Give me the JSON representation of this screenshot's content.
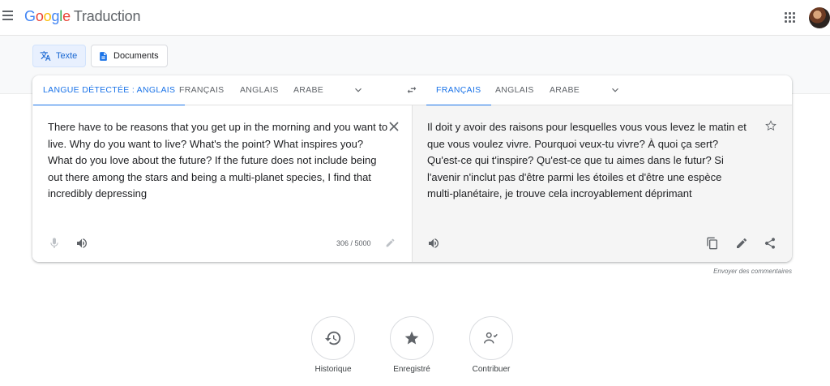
{
  "header": {
    "brand": [
      "G",
      "o",
      "o",
      "g",
      "l",
      "e"
    ],
    "product": "Traduction"
  },
  "modes": {
    "text": "Texte",
    "documents": "Documents"
  },
  "source_tabs": [
    "LANGUE DÉTECTÉE : ANGLAIS",
    "FRANÇAIS",
    "ANGLAIS",
    "ARABE"
  ],
  "target_tabs": [
    "FRANÇAIS",
    "ANGLAIS",
    "ARABE"
  ],
  "source_text": "There have to be reasons that you get up in the morning and you want to live. Why do you want to live? What's the point? What inspires you? What do you love about the future? If the future does not include being out there among the stars and being a multi-planet species, I find that incredibly depressing",
  "translated_text": "Il doit y avoir des raisons pour lesquelles vous vous levez le matin et que vous voulez vivre. Pourquoi veux-tu vivre? À quoi ça sert? Qu'est-ce qui t'inspire? Qu'est-ce que tu aimes dans le futur? Si l'avenir n'inclut pas d'être parmi les étoiles et d'être une espèce multi-planétaire, je trouve cela incroyablement déprimant",
  "char_count": "306 / 5000",
  "feedback": "Envoyer des commentaires",
  "bottom": {
    "history": "Historique",
    "saved": "Enregistré",
    "contribute": "Contribuer"
  },
  "icons": [
    "menu-icon",
    "apps-icon",
    "translate-icon",
    "document-icon",
    "chevron-down-icon",
    "swap-icon",
    "close-icon",
    "star-icon",
    "mic-icon",
    "speaker-icon",
    "pencil-icon",
    "copy-icon",
    "share-icon",
    "history-icon",
    "saved-star-icon",
    "contribute-icon"
  ],
  "colors": {
    "accent": "#1a73e8",
    "active_tab": "#1a73e8",
    "target_bg": "#f5f5f5",
    "band_bg": "#f8f9fa"
  }
}
